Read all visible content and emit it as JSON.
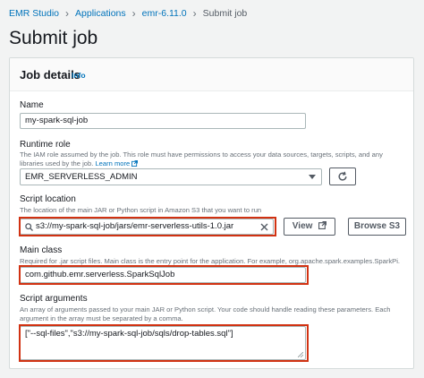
{
  "breadcrumb": {
    "items": [
      "EMR Studio",
      "Applications",
      "emr-6.11.0"
    ],
    "current": "Submit job"
  },
  "page": {
    "title": "Submit job"
  },
  "panel": {
    "title": "Job details",
    "info": "Info"
  },
  "name_field": {
    "label": "Name",
    "value": "my-spark-sql-job"
  },
  "runtime_role": {
    "label": "Runtime role",
    "description": "The IAM role assumed by the job. This role must have permissions to access your data sources, targets, scripts, and any libraries used by the job.",
    "learn_more": "Learn more",
    "value": "EMR_SERVERLESS_ADMIN"
  },
  "script_location": {
    "label": "Script location",
    "description": "The location of the main JAR or Python script in Amazon S3 that you want to run",
    "value": "s3://my-spark-sql-job/jars/emr-serverless-utils-1.0.jar",
    "view_label": "View",
    "browse_label": "Browse S3"
  },
  "main_class": {
    "label": "Main class",
    "description": "Required for .jar script files. Main class is the entry point for the application. For example, org.apache.spark.examples.SparkPi.",
    "value": "com.github.emr.serverless.SparkSqlJob"
  },
  "script_arguments": {
    "label": "Script arguments",
    "description": "An array of arguments passed to your main JAR or Python script. Your code should handle reading these parameters. Each argument in the array must be separated by a comma.",
    "value": "[\"--sql-files\",\"s3://my-spark-sql-job/sqls/drop-tables.sql\"]"
  },
  "colors": {
    "link": "#0073bb",
    "highlight": "#d13212",
    "border": "#aab7b8"
  }
}
